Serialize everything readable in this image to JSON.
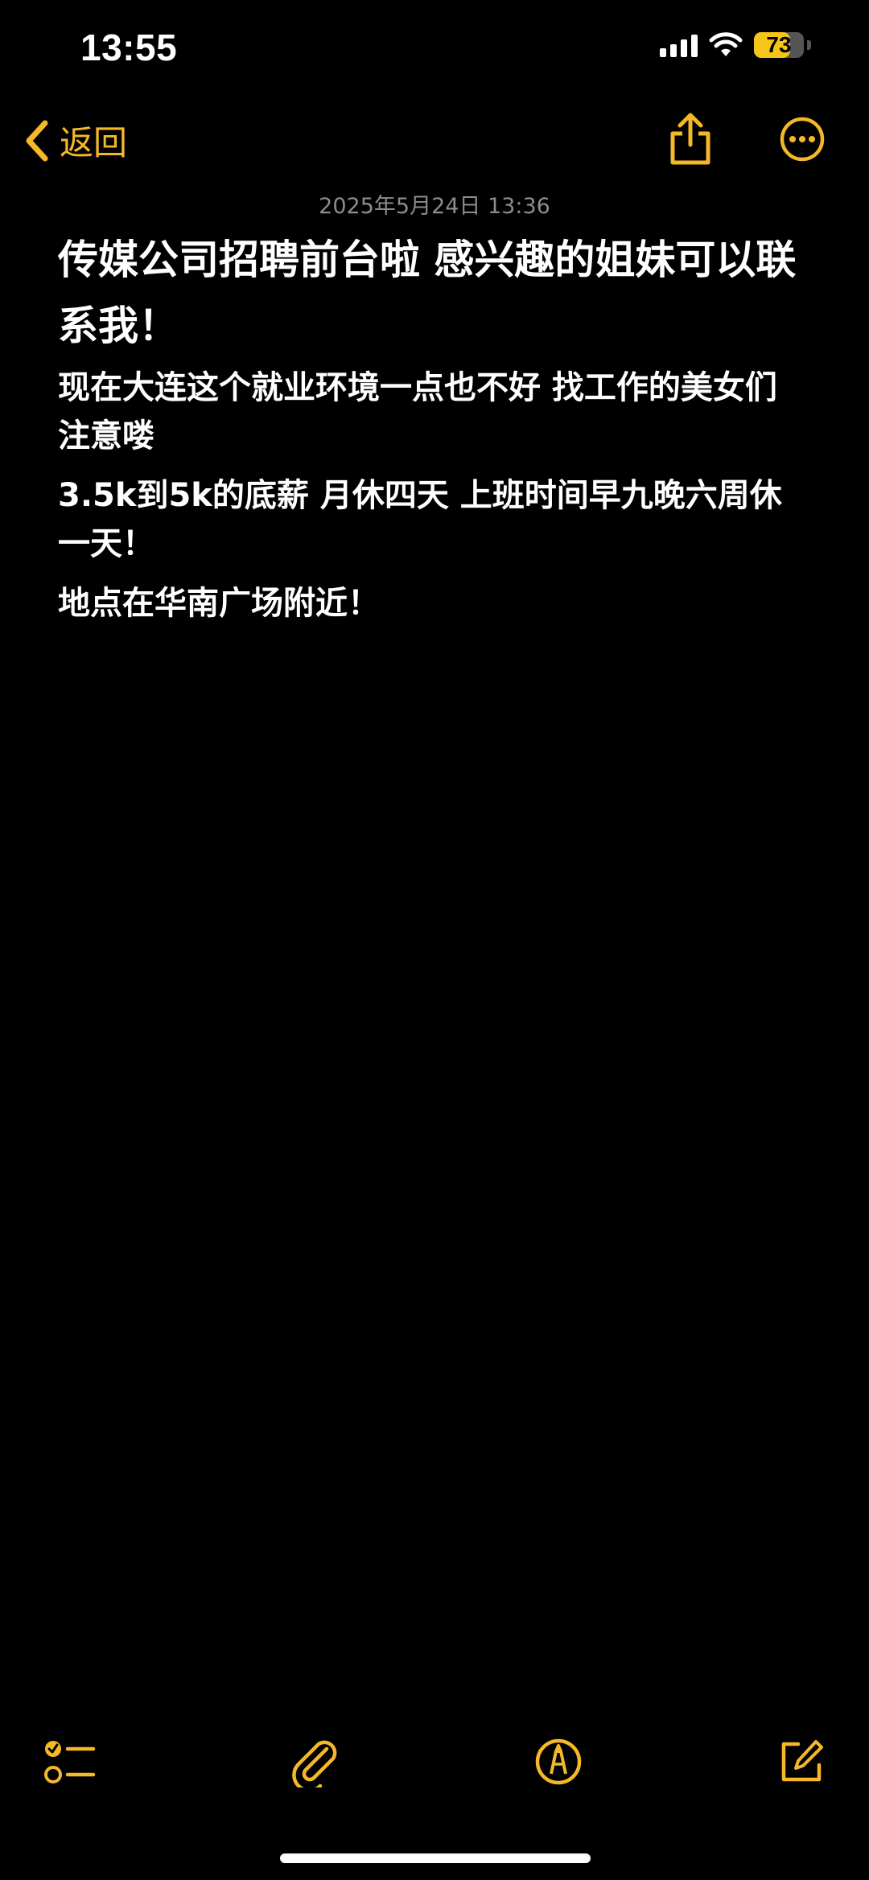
{
  "status_bar": {
    "time": "13:55",
    "battery_level": "73",
    "battery_fraction": 0.73
  },
  "nav": {
    "back_label": "返回"
  },
  "note": {
    "date": "2025年5月24日 13:36",
    "title": "传媒公司招聘前台啦 感兴趣的姐妹可以联系我！",
    "paragraphs": [
      "现在大连这个就业环境一点也不好 找工作的美女们注意喽",
      "3.5k到5k的底薪 月休四天 上班时间早九晚六周休一天！",
      "地点在华南广场附近！"
    ]
  },
  "icons": {
    "accent_color": "#f5b829",
    "toolbar": [
      "checklist-icon",
      "paperclip-icon",
      "markup-pen-icon",
      "compose-icon"
    ]
  }
}
